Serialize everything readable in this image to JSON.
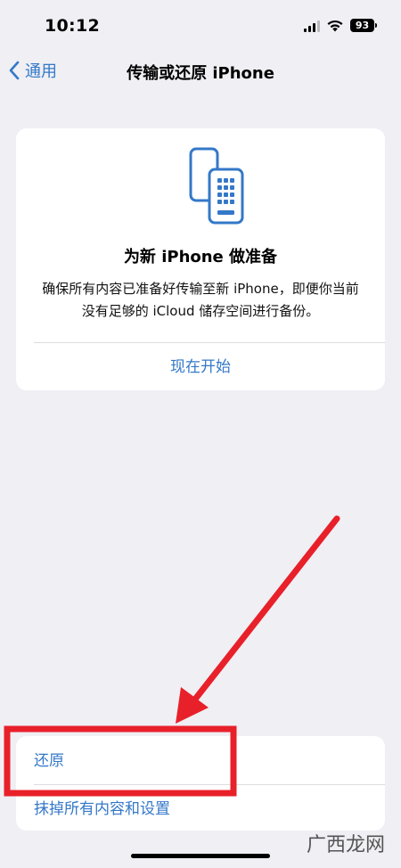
{
  "status_bar": {
    "time": "10:12",
    "battery": "93"
  },
  "nav": {
    "back_label": "通用",
    "title": "传输或还原 iPhone"
  },
  "prepare_card": {
    "icon": "phone-transfer-icon",
    "title": "为新 iPhone 做准备",
    "description": "确保所有内容已准备好传输至新 iPhone，即便你当前没有足够的 iCloud 储存空间进行备份。",
    "action_label": "现在开始"
  },
  "options": {
    "items": [
      {
        "label": "还原"
      },
      {
        "label": "抹掉所有内容和设置"
      }
    ]
  },
  "annotation": {
    "arrow_color": "#e8202a",
    "highlight_color": "#e8202a"
  },
  "watermark": {
    "text": "广西龙网"
  },
  "colors": {
    "accent": "#3478c8",
    "background": "#efeff4",
    "card": "#ffffff"
  }
}
